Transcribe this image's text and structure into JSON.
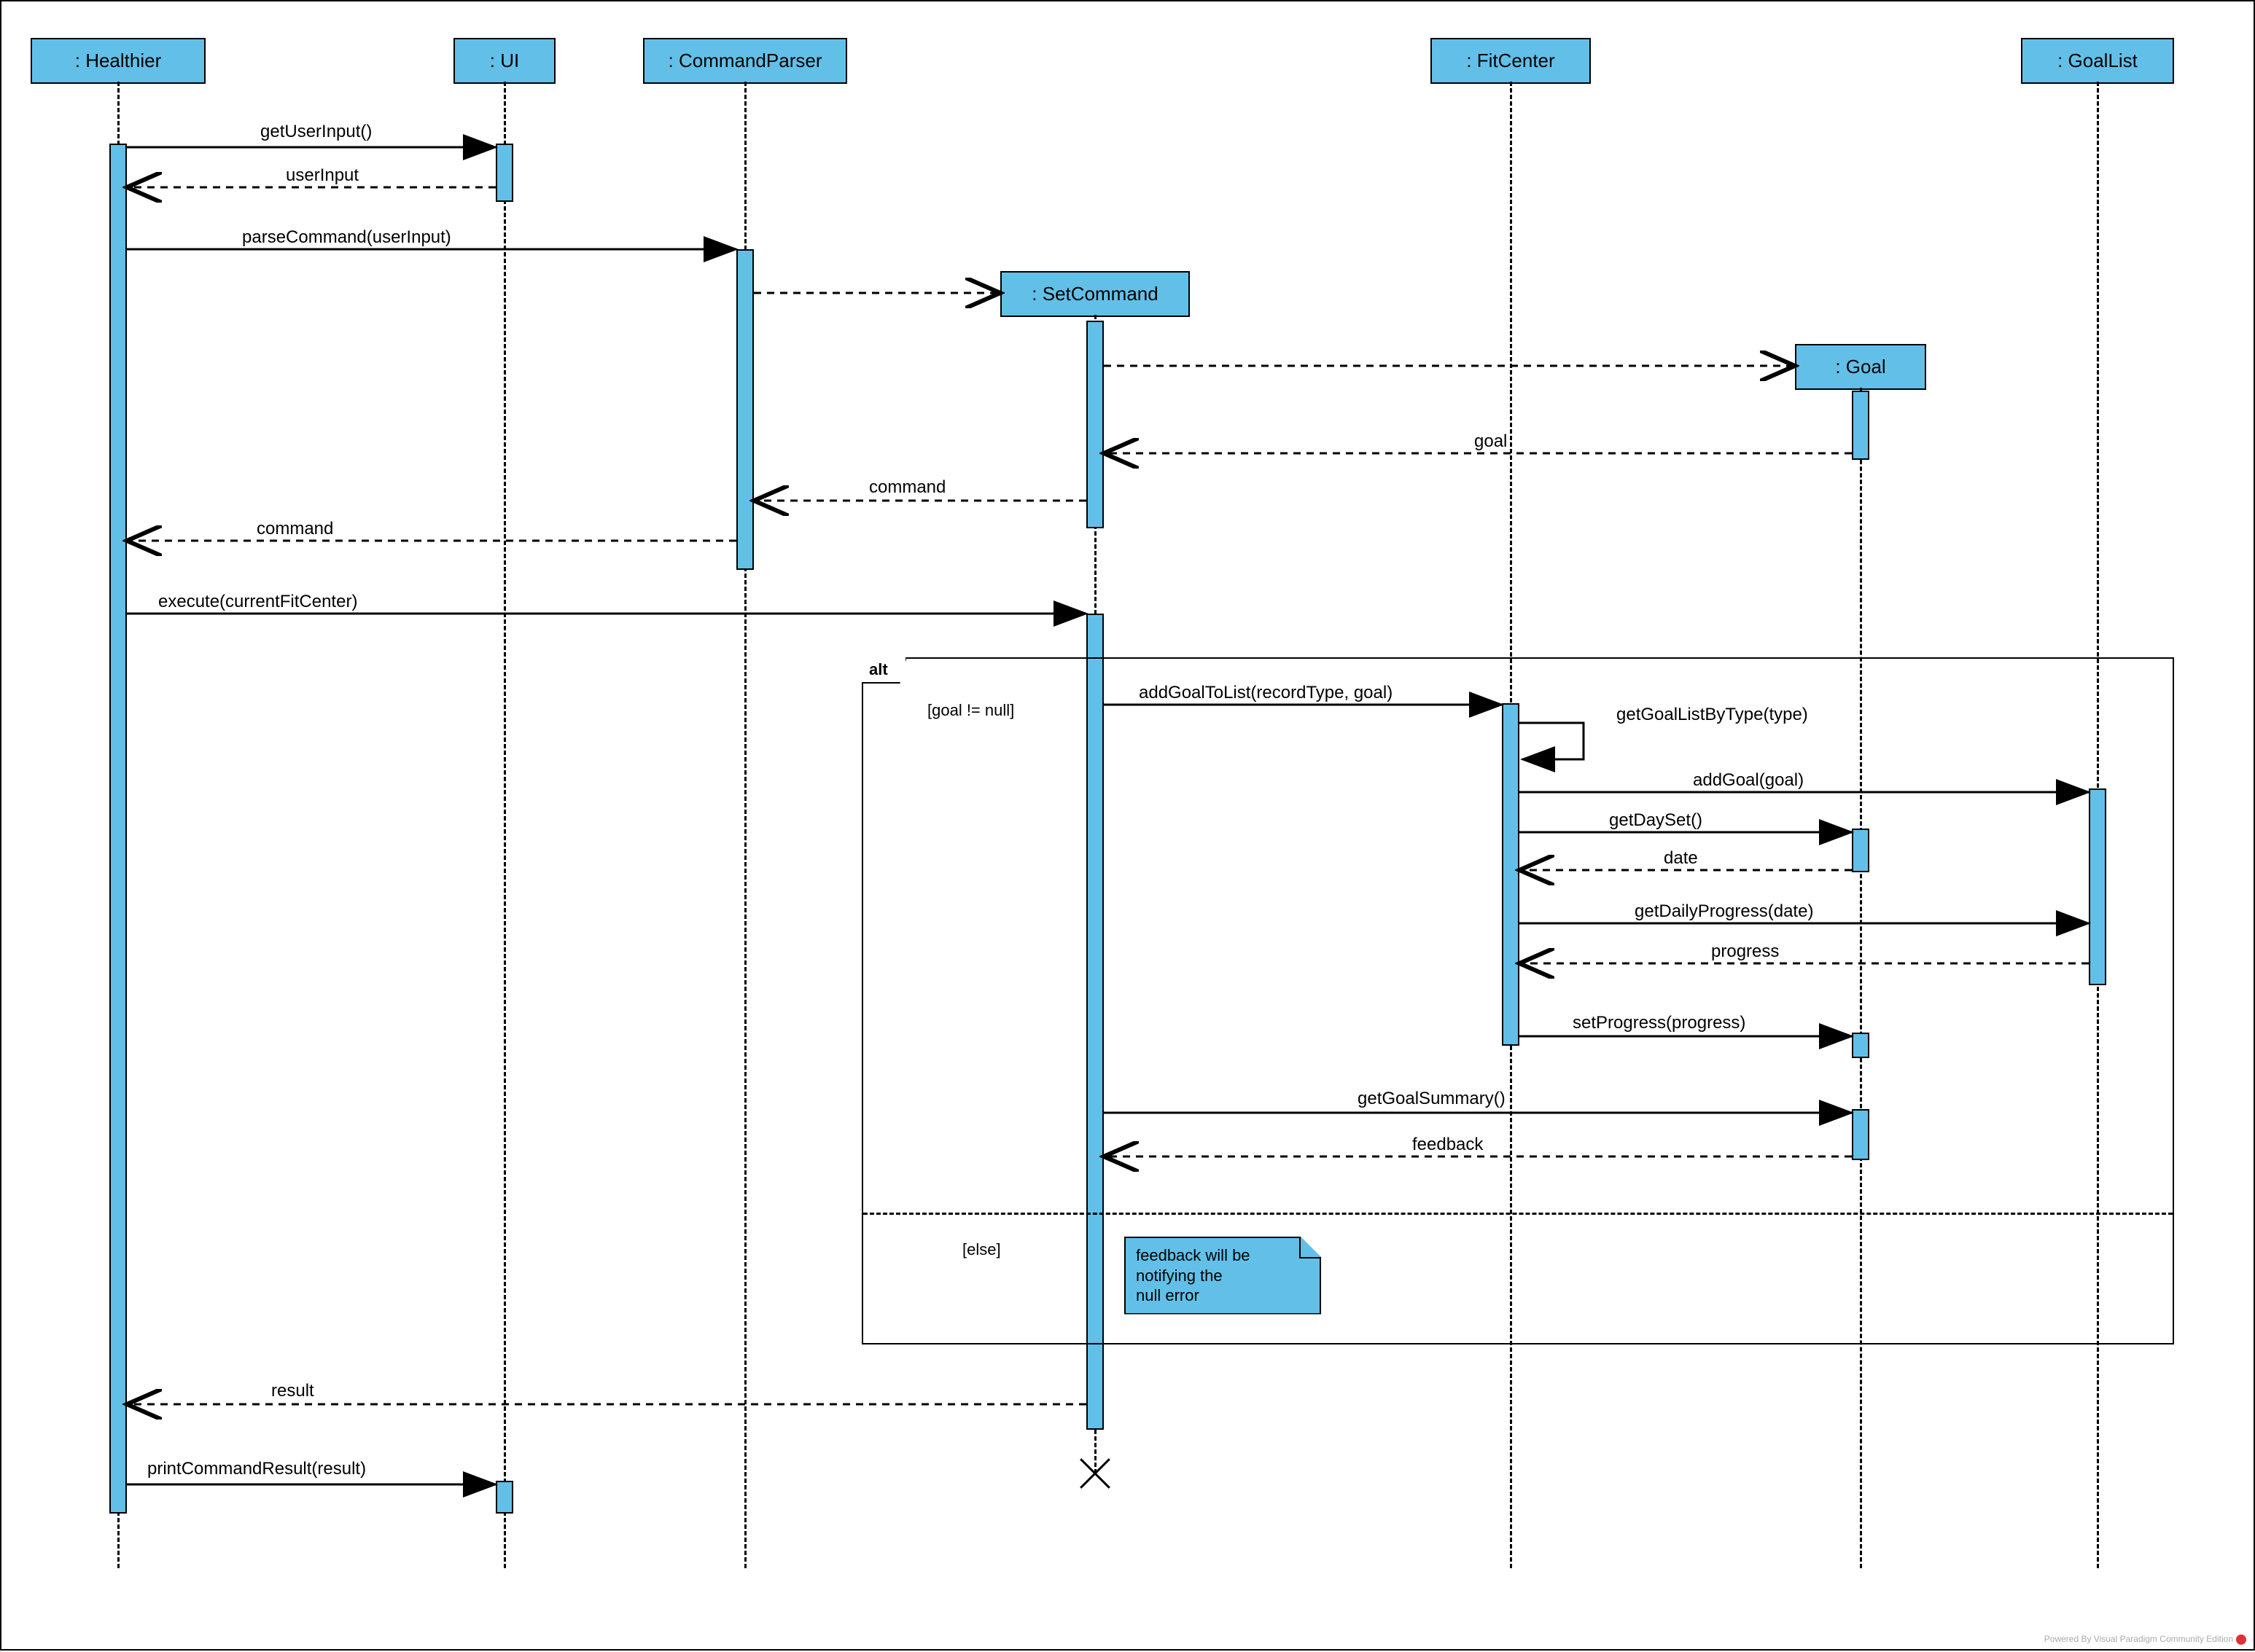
{
  "diagram_type": "UML Sequence Diagram",
  "lifelines": {
    "healthier": ": Healthier",
    "ui": ": UI",
    "commandParser": ": CommandParser",
    "setCommand": ": SetCommand",
    "fitCenter": ": FitCenter",
    "goal": ": Goal",
    "goalList": ": GoalList"
  },
  "messages": {
    "m1": "getUserInput()",
    "m2": "userInput",
    "m3": "parseCommand(userInput)",
    "m4_goal_return": "goal",
    "m5_command_return1": "command",
    "m6_command_return2": "command",
    "m7": "execute(currentFitCenter)",
    "m8": "addGoalToList(recordType, goal)",
    "m9_self": "getGoalListByType(type)",
    "m10": "addGoal(goal)",
    "m11": "getDaySet()",
    "m12": "date",
    "m13": "getDailyProgress(date)",
    "m14": "progress",
    "m15": "setProgress(progress)",
    "m16": "getGoalSummary()",
    "m17": "feedback",
    "m18": "result",
    "m19": "printCommandResult(result)"
  },
  "frame": {
    "operator": "alt",
    "guard1": "[goal != null]",
    "guard2": "[else]"
  },
  "note": {
    "line1": "feedback will be",
    "line2": "notifying the",
    "line3": "null error"
  },
  "watermark": "Powered By Visual Paradigm Community Edition"
}
